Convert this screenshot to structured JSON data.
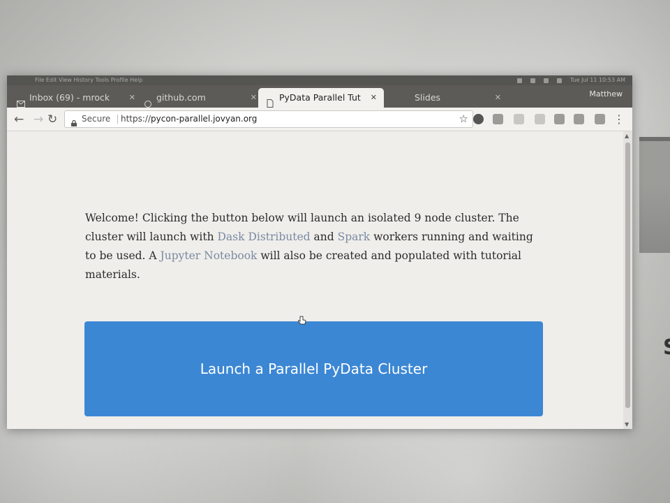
{
  "os_bar": {
    "menu_text": "File  Edit  View  History  Tools  Profile  Help",
    "clock": "Tue Jul 11  10:53 AM"
  },
  "tabs": [
    {
      "label": "Inbox (69) - mrock",
      "icon": "gmail-icon",
      "active": false
    },
    {
      "label": "github.com",
      "icon": "github-icon",
      "active": false
    },
    {
      "label": "PyData Parallel Tut",
      "icon": "page-icon",
      "active": true
    },
    {
      "label": "Slides",
      "icon": "slides-icon",
      "active": false
    }
  ],
  "profile": {
    "name": "Matthew"
  },
  "toolbar": {
    "secure_label": "Secure",
    "url_prefix": "https://",
    "url_host": "pycon-parallel.jovyan.org"
  },
  "page": {
    "intro_1": "Welcome! Clicking the button below will launch an isolated 9 node cluster. The cluster will launch with ",
    "link_dask": "Dask Distributed",
    "intro_2": " and ",
    "link_spark": "Spark",
    "intro_3": " workers running and waiting to be used. A ",
    "link_jupyter": "Jupyter Notebook",
    "intro_4": " will also be created and populated with tutorial materials.",
    "launch_button": "Launch a Parallel PyData Cluster"
  },
  "colors": {
    "button": "#3c87d4",
    "link": "#7a8aa0",
    "page_bg": "#efeeeb"
  }
}
